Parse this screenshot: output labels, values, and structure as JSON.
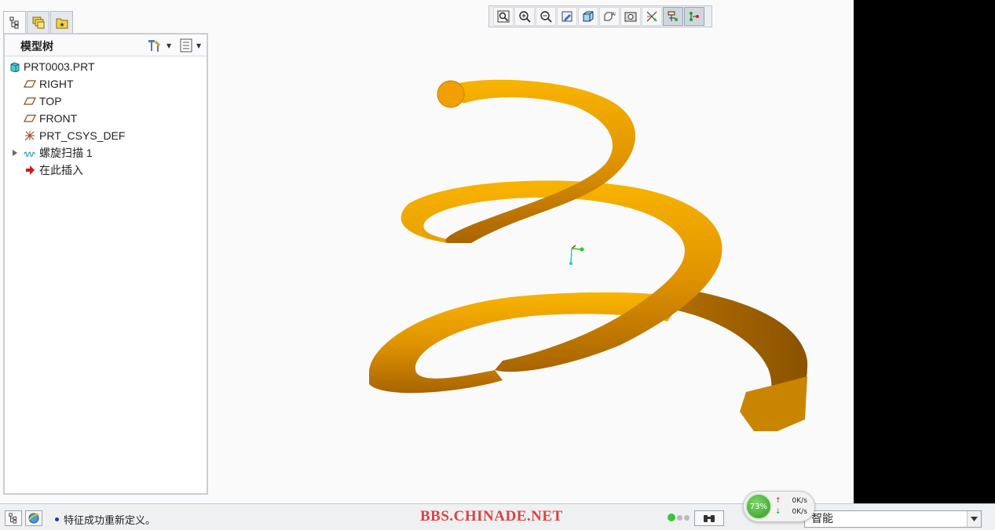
{
  "left_tabs": [
    {
      "icon": "model-tree-icon",
      "active": true
    },
    {
      "icon": "layers-icon",
      "active": false
    },
    {
      "icon": "folder-favorites-icon",
      "active": false
    }
  ],
  "panel": {
    "title": "模型树",
    "settings_icon": "tree-settings-icon",
    "show_icon": "tree-show-icon"
  },
  "tree": [
    {
      "label": "PRT0003.PRT",
      "icon": "part-icon",
      "indent": 0,
      "expander": false
    },
    {
      "label": "RIGHT",
      "icon": "datum-plane-icon",
      "indent": 1,
      "expander": false
    },
    {
      "label": "TOP",
      "icon": "datum-plane-icon",
      "indent": 1,
      "expander": false
    },
    {
      "label": "FRONT",
      "icon": "datum-plane-icon",
      "indent": 1,
      "expander": false
    },
    {
      "label": "PRT_CSYS_DEF",
      "icon": "coordinate-system-icon",
      "indent": 1,
      "expander": false
    },
    {
      "label": "螺旋扫描 1",
      "icon": "helical-sweep-icon",
      "indent": 1,
      "expander": true
    },
    {
      "label": "在此插入",
      "icon": "insert-here-icon",
      "indent": 1,
      "expander": false
    }
  ],
  "toolbar": [
    {
      "icon": "zoom-fit-icon",
      "on": false
    },
    {
      "icon": "zoom-in-icon",
      "on": false
    },
    {
      "icon": "zoom-out-icon",
      "on": false
    },
    {
      "icon": "repaint-icon",
      "on": false
    },
    {
      "icon": "display-style-icon",
      "on": false
    },
    {
      "icon": "saved-orientations-icon",
      "on": false
    },
    {
      "icon": "view-manager-icon",
      "on": false
    },
    {
      "icon": "datum-display-icon",
      "on": false
    },
    {
      "icon": "spin-center-icon",
      "on": true
    },
    {
      "icon": "annotation-display-icon",
      "on": true
    }
  ],
  "statusbar": {
    "message": "特征成功重新定义。",
    "watermark": "BBS.CHINADE.NET",
    "filter_value": "智能"
  },
  "net_widget": {
    "percent": "73%",
    "upload": "0K/s",
    "download": "0K/s"
  },
  "colors": {
    "spring": "#e8a000",
    "watermark": "#e04040"
  }
}
